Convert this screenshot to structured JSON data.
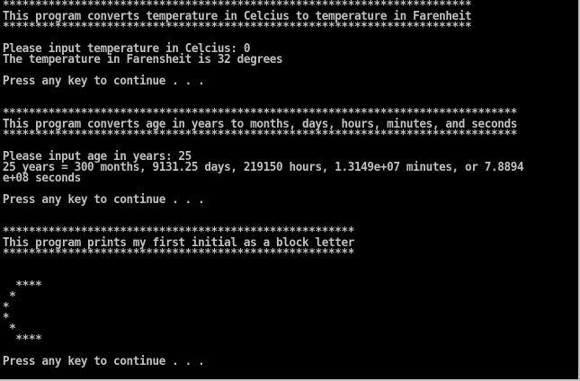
{
  "console": {
    "text_color": "#c0c0c0",
    "background_color": "#000000",
    "lines": [
      "************************************************************************",
      "This program converts temperature in Celcius to temperature in Farenheit",
      "************************************************************************",
      "",
      "Please input temperature in Celcius: 0",
      "The temperature in Farensheit is 32 degrees",
      "",
      "Press any key to continue . . .",
      "",
      "",
      "*******************************************************************************",
      "This program converts age in years to months, days, hours, minutes, and seconds",
      "*******************************************************************************",
      "",
      "Please input age in years: 25",
      "25 years = 300 months, 9131.25 days, 219150 hours, 1.3149e+07 minutes, or 7.8894",
      "e+08 seconds",
      "",
      "Press any key to continue . . .",
      "",
      "",
      "******************************************************",
      "This program prints my first initial as a block letter",
      "******************************************************",
      "",
      "",
      "  ****",
      " *",
      "*",
      "*",
      " *",
      "  ****",
      "",
      "Press any key to continue . . ."
    ]
  }
}
